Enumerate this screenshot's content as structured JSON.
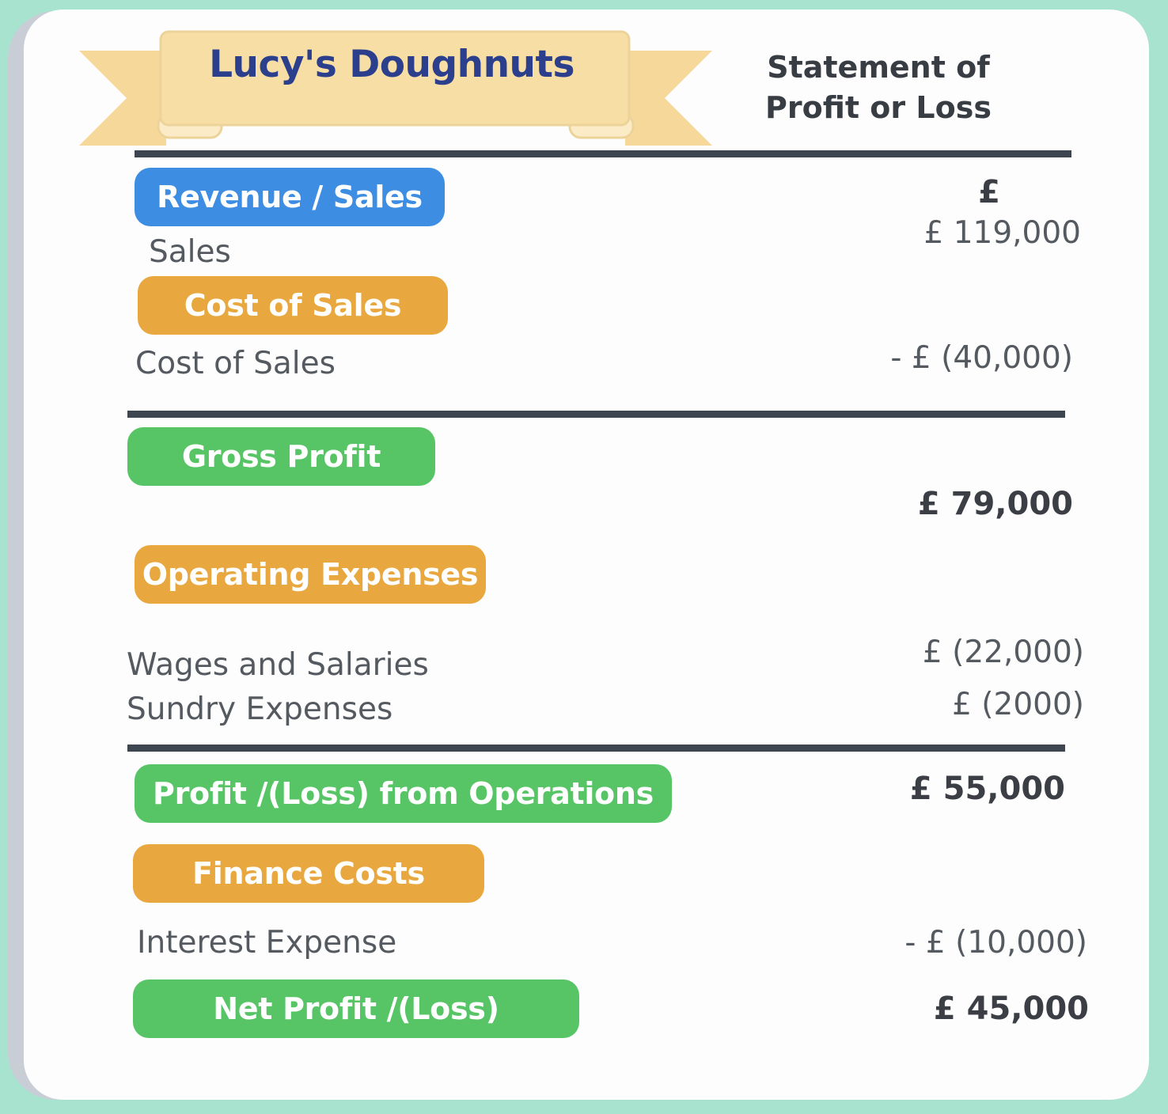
{
  "header": {
    "company_name": "Lucy's Doughnuts",
    "statement_line1": "Statement of",
    "statement_line2": "Profit or Loss",
    "currency_symbol": "£"
  },
  "sections": {
    "revenue": {
      "heading": "Revenue / Sales",
      "items": [
        {
          "label": "Sales",
          "amount": "£ 119,000"
        }
      ]
    },
    "cost_of_sales": {
      "heading": "Cost of Sales",
      "items": [
        {
          "label": "Cost of Sales",
          "amount": "- £ (40,000)"
        }
      ]
    },
    "gross_profit": {
      "heading": "Gross Profit",
      "total": "£ 79,000"
    },
    "operating_expenses": {
      "heading": "Operating Expenses",
      "items": [
        {
          "label": "Wages and Salaries",
          "amount": "£ (22,000)"
        },
        {
          "label": "Sundry Expenses",
          "amount": "£ (2000)"
        }
      ]
    },
    "operating_profit": {
      "heading": "Profit /(Loss) from Operations",
      "total": "£ 55,000"
    },
    "finance_costs": {
      "heading": "Finance Costs",
      "items": [
        {
          "label": "Interest Expense",
          "amount": "- £ (10,000)"
        }
      ]
    },
    "net_profit": {
      "heading": "Net Profit /(Loss)",
      "total": "£ 45,000"
    }
  },
  "colors": {
    "background": "#a8e3d0",
    "revenue_pill": "#3d8ee3",
    "cost_pill": "#e8a83f",
    "profit_pill": "#57c566",
    "banner": "#f7dea5",
    "title_text": "#2b3f8c"
  }
}
